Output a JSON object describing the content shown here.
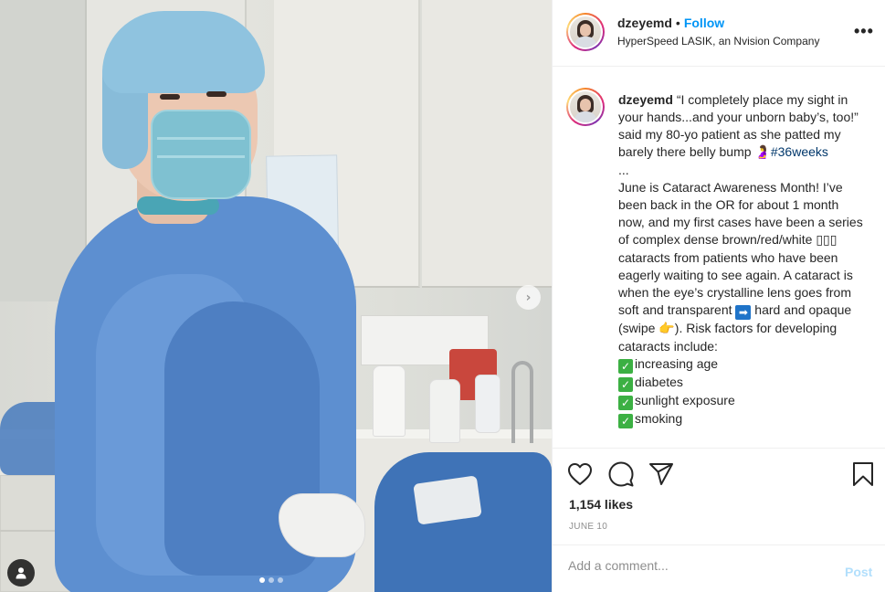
{
  "post": {
    "username": "dzeyemd",
    "separator": "•",
    "follow_label": "Follow",
    "location": "HyperSpeed LASIK, an Nvision Company",
    "more_label": "•••"
  },
  "caption": {
    "username": "dzeyemd",
    "line1": "“I completely place my sight in your hands...and your unborn baby’s, too!” said my 80-yo patient as she patted my barely there belly bump ",
    "pregnant_emoji": "🤰",
    "hashtag": "#36weeks",
    "ellipsis": "...",
    "para2_a": "June is Cataract Awareness Month! I’ve been back in the OR for about 1 month now, and my first cases have been a series of complex dense brown/red/white ",
    "boxes": "▯▯▯",
    "para2_b": " cataracts from patients who have been eagerly waiting to see again. A cataract is when the eye’s crystalline lens goes from soft and transparent ",
    "arrow": "➡",
    "para2_c": " hard and opaque (swipe ",
    "point_emoji": "👉",
    "para2_d": "). Risk factors for developing cataracts include:",
    "check": "✓",
    "risk_factors": [
      "increasing age",
      "diabetes",
      "sunlight exposure",
      "smoking"
    ]
  },
  "engagement": {
    "likes": "1,154 likes",
    "date": "JUNE 10"
  },
  "comment": {
    "placeholder": "Add a comment...",
    "post_label": "Post"
  },
  "carousel": {
    "next_glyph": "›",
    "slide_count": 3,
    "active_index": 0
  },
  "colors": {
    "accent": "#0095f6",
    "post_disabled": "#b2dffc",
    "hashtag": "#00376b",
    "check_green": "#3cb043"
  },
  "icons": [
    "heart-icon",
    "comment-icon",
    "share-icon",
    "bookmark-icon",
    "next-arrow-icon",
    "user-tag-icon"
  ]
}
